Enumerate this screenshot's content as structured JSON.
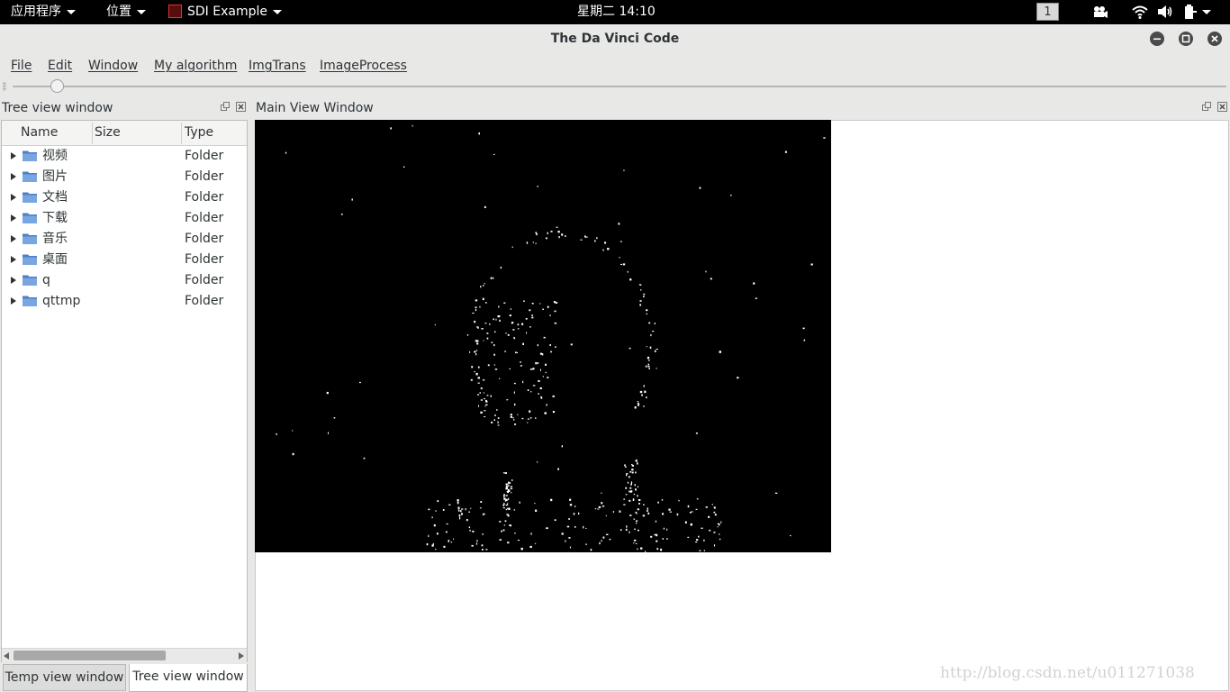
{
  "topbar": {
    "applications": "应用程序",
    "places": "位置",
    "app_name": "SDI Example",
    "clock": "星期二 14:10",
    "workspace": "1"
  },
  "window": {
    "title": "The Da Vinci Code"
  },
  "menu": {
    "file": "File",
    "edit": "Edit",
    "window": "Window",
    "my_algorithm": "My algorithm",
    "imgtrans": "ImgTrans",
    "imageprocess": "ImageProcess"
  },
  "slider": {
    "value_fraction": 0.04
  },
  "tree_dock": {
    "title": "Tree view window",
    "columns": {
      "name": "Name",
      "size": "Size",
      "type": "Type"
    },
    "rows": [
      {
        "name": "视频",
        "size": "",
        "type": "Folder"
      },
      {
        "name": "图片",
        "size": "",
        "type": "Folder"
      },
      {
        "name": "文档",
        "size": "",
        "type": "Folder"
      },
      {
        "name": "下载",
        "size": "",
        "type": "Folder"
      },
      {
        "name": "音乐",
        "size": "",
        "type": "Folder"
      },
      {
        "name": "桌面",
        "size": "",
        "type": "Folder"
      },
      {
        "name": "q",
        "size": "",
        "type": "Folder"
      },
      {
        "name": "qttmp",
        "size": "",
        "type": "Folder"
      }
    ]
  },
  "main_dock": {
    "title": "Main View Window"
  },
  "tabs": {
    "temp": "Temp view window",
    "tree": "Tree view window"
  },
  "watermark": "http://blog.csdn.net/u011271038",
  "colors": {
    "topbar_bg": "#000000",
    "window_bg": "#e8e8e7",
    "folder_blue": "#6f9ad6",
    "image_bg": "#000000",
    "image_speckle": "#ffffff"
  }
}
